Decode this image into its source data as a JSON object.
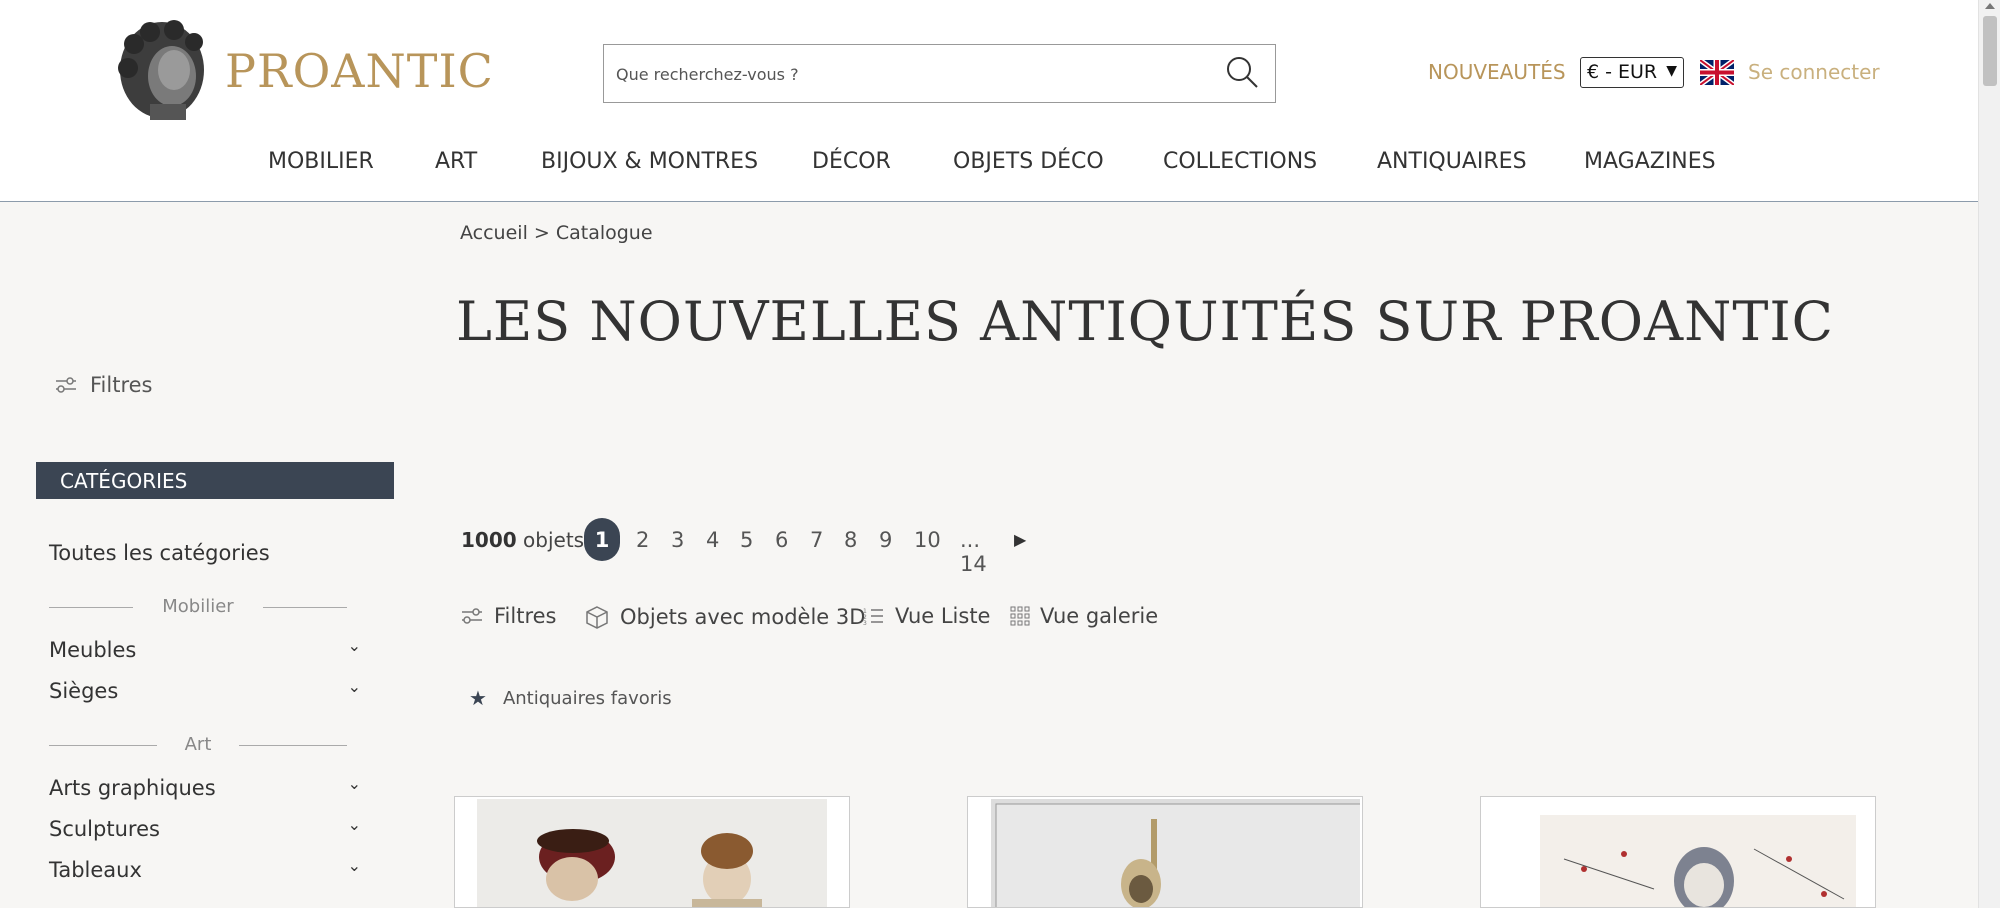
{
  "header": {
    "logo_text": "PROANTIC",
    "search_placeholder": "Que recherchez-vous ?",
    "nouveautes": "NOUVEAUTÉS",
    "currency": "€ - EUR",
    "login": "Se connecter"
  },
  "nav": [
    "MOBILIER",
    "ART",
    "BIJOUX & MONTRES",
    "DÉCOR",
    "OBJETS DÉCO",
    "COLLECTIONS",
    "ANTIQUAIRES",
    "MAGAZINES"
  ],
  "breadcrumb": "Accueil > Catalogue",
  "page_title": "LES NOUVELLES ANTIQUITÉS SUR PROANTIC",
  "sidebar": {
    "filters": "Filtres",
    "categories_header": "CATÉGORIES",
    "all_categories": "Toutes les catégories",
    "group_mobilier": "Mobilier",
    "meubles": "Meubles",
    "sieges": "Sièges",
    "group_art": "Art",
    "arts_graphiques": "Arts graphiques",
    "sculptures": "Sculptures",
    "tableaux": "Tableaux"
  },
  "results": {
    "count_number": "1000",
    "count_label": "objets",
    "pages": [
      "1",
      "2",
      "3",
      "4",
      "5",
      "6",
      "7",
      "8",
      "9",
      "10",
      "... 14"
    ],
    "current_page": "1"
  },
  "toolbar": {
    "filters": "Filtres",
    "objects_3d": "Objets avec modèle 3D",
    "list_view": "Vue Liste",
    "gallery_view": "Vue galerie"
  },
  "favorites": "Antiquaires favoris",
  "colors": {
    "brand_gold": "#b8955a",
    "dark_slate": "#3b4553"
  }
}
